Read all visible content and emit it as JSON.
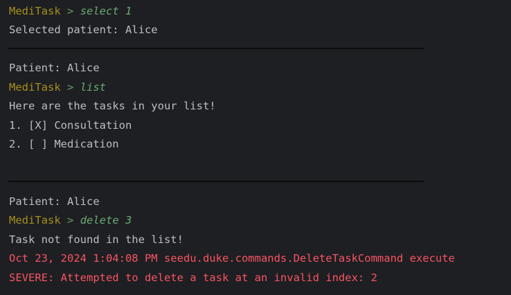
{
  "prompt": {
    "app": "MediTask",
    "separator": ">"
  },
  "blocks": [
    {
      "command": "select 1",
      "output": [
        "Selected patient: Alice"
      ]
    },
    {
      "patient_line": "Patient: Alice",
      "command": "list",
      "output": [
        "Here are the tasks in your list!",
        "1. [X] Consultation",
        "2. [ ] Medication"
      ]
    },
    {
      "patient_line": "Patient: Alice",
      "command": "delete 3",
      "output": [
        "Task not found in the list!"
      ],
      "log": [
        "Oct 23, 2024 1:04:08 PM seedu.duke.commands.DeleteTaskCommand execute",
        "SEVERE: Attempted to delete a task at an invalid index: 2"
      ]
    }
  ],
  "colors": {
    "background": "#1e1f22",
    "app_name": "#a8901f",
    "command": "#6aab73",
    "text": "#bcbec4",
    "error": "#f75464"
  }
}
